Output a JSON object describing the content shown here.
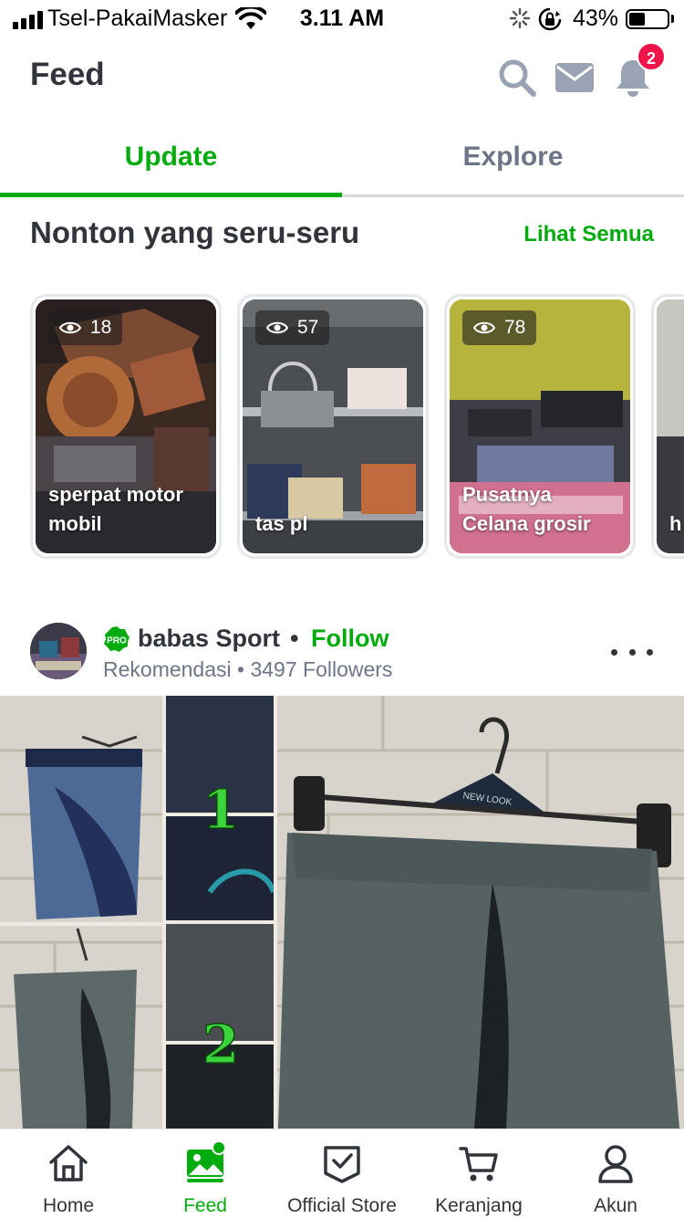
{
  "status_bar": {
    "carrier": "Tsel-PakaiMasker",
    "time": "3.11 AM",
    "battery_percent": "43%",
    "battery_level": 0.43
  },
  "header": {
    "title": "Feed",
    "icons": [
      "search-icon",
      "mail-icon",
      "bell-icon"
    ],
    "notification_count": "2"
  },
  "tabs": {
    "items": [
      {
        "label": "Update",
        "active": true
      },
      {
        "label": "Explore",
        "active": false
      }
    ]
  },
  "colors": {
    "accent": "#03ac0e",
    "badge": "#ef144a",
    "text_primary": "#31353b",
    "text_secondary": "#6d7588"
  },
  "section": {
    "title": "Nonton yang seru-seru",
    "see_all": "Lihat Semua"
  },
  "videos": [
    {
      "views": "18",
      "caption": "sperpat motor mobil"
    },
    {
      "views": "57",
      "caption": "tas pl"
    },
    {
      "views": "78",
      "caption": "Pusatnya Celana grosir"
    },
    {
      "views": "",
      "caption": "h k"
    }
  ],
  "post": {
    "shop_name": "babas Sport",
    "separator": "•",
    "follow_label": "Follow",
    "subtitle": "Rekomendasi • 3497 Followers",
    "image_numbers": [
      "1",
      "2"
    ],
    "hanger_brand": "NEW LOOK"
  },
  "bottom_nav": {
    "items": [
      {
        "label": "Home",
        "icon": "home-icon",
        "active": false
      },
      {
        "label": "Feed",
        "icon": "feed-icon",
        "active": true
      },
      {
        "label": "Official Store",
        "icon": "official-store-icon",
        "active": false
      },
      {
        "label": "Keranjang",
        "icon": "cart-icon",
        "active": false
      },
      {
        "label": "Akun",
        "icon": "account-icon",
        "active": false
      }
    ]
  }
}
